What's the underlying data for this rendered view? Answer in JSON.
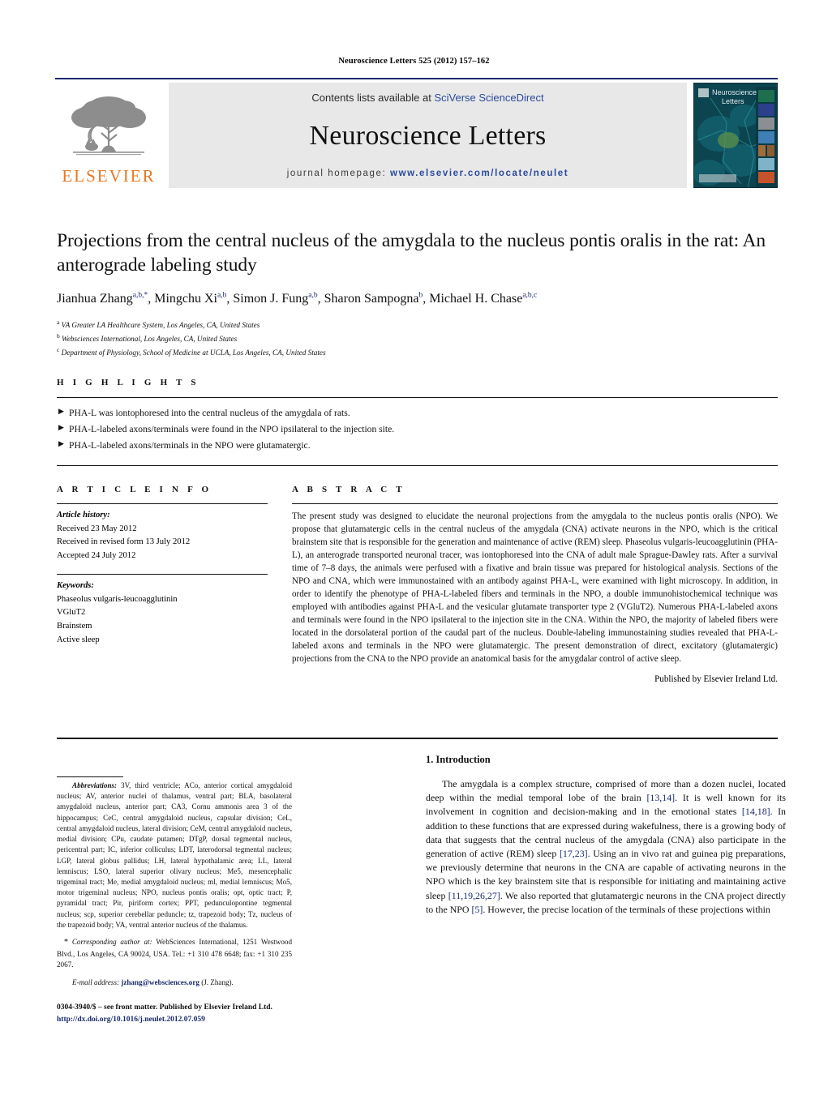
{
  "running_head": "Neuroscience Letters 525 (2012) 157–162",
  "masthead": {
    "contents_prefix": "Contents lists available at ",
    "contents_link": "SciVerse ScienceDirect",
    "journal_name": "Neuroscience Letters",
    "homepage_label": "journal homepage:",
    "homepage_url": "www.elsevier.com/locate/neulet",
    "publisher_wordmark": "ELSEVIER",
    "publisher_color": "#E87722",
    "cover_title_line1": "Neuroscience",
    "cover_title_line2": "Letters",
    "accent_color": "#1a2a6c",
    "link_color": "#2b4a9b"
  },
  "article": {
    "title": "Projections from the central nucleus of the amygdala to the nucleus pontis oralis in the rat: An anterograde labeling study",
    "authors_html": "Jianhua Zhang<sup>a,b,*</sup>, Mingchu Xi<sup>a,b</sup>, Simon J. Fung<sup>a,b</sup>, Sharon Sampogna<sup>b</sup>, Michael H. Chase<sup>a,b,c</sup>",
    "affiliations": [
      {
        "mark": "a",
        "text": "VA Greater LA Healthcare System, Los Angeles, CA, United States"
      },
      {
        "mark": "b",
        "text": "Websciences International, Los Angeles, CA, United States"
      },
      {
        "mark": "c",
        "text": "Department of Physiology, School of Medicine at UCLA, Los Angeles, CA, United States"
      }
    ]
  },
  "highlights": {
    "heading": "H I G H L I G H T S",
    "bullet_glyph": "▶",
    "items": [
      "PHA-L was iontophoresed into the central nucleus of the amygdala of rats.",
      "PHA-L-labeled axons/terminals were found in the NPO ipsilateral to the injection site.",
      "PHA-L-labeled axons/terminals in the NPO were glutamatergic."
    ]
  },
  "article_info": {
    "heading": "A R T I C L E    I N F O",
    "history_label": "Article history:",
    "history": [
      "Received 23 May 2012",
      "Received in revised form 13 July 2012",
      "Accepted 24 July 2012"
    ],
    "keywords_label": "Keywords:",
    "keywords": [
      "Phaseolus vulgaris-leucoagglutinin",
      "VGluT2",
      "Brainstem",
      "Active sleep"
    ]
  },
  "abstract": {
    "heading": "A B S T R A C T",
    "text": "The present study was designed to elucidate the neuronal projections from the amygdala to the nucleus pontis oralis (NPO). We propose that glutamatergic cells in the central nucleus of the amygdala (CNA) activate neurons in the NPO, which is the critical brainstem site that is responsible for the generation and maintenance of active (REM) sleep. Phaseolus vulgaris-leucoagglutinin (PHA-L), an anterograde transported neuronal tracer, was iontophoresed into the CNA of adult male Sprague-Dawley rats. After a survival time of 7–8 days, the animals were perfused with a fixative and brain tissue was prepared for histological analysis. Sections of the NPO and CNA, which were immunostained with an antibody against PHA-L, were examined with light microscopy. In addition, in order to identify the phenotype of PHA-L-labeled fibers and terminals in the NPO, a double immunohistochemical technique was employed with antibodies against PHA-L and the vesicular glutamate transporter type 2 (VGluT2). Numerous PHA-L-labeled axons and terminals were found in the NPO ipsilateral to the injection site in the CNA. Within the NPO, the majority of labeled fibers were located in the dorsolateral portion of the caudal part of the nucleus. Double-labeling immunostaining studies revealed that PHA-L-labeled axons and terminals in the NPO were glutamatergic. The present demonstration of direct, excitatory (glutamatergic) projections from the CNA to the NPO provide an anatomical basis for the amygdalar control of active sleep.",
    "publisher_line": "Published by Elsevier Ireland Ltd."
  },
  "footnotes": {
    "abbreviations_label": "Abbreviations:",
    "abbreviations_text": "3V, third ventricle; ACo, anterior cortical amygdaloid nucleus; AV, anterior nuclei of thalamus, ventral part; BLA, basolateral amygdaloid nucleus, anterior part; CA3, Cornu ammonis area 3 of the hippocampus; CeC, central amygdaloid nucleus, capsular division; CeL, central amygdaloid nucleus, lateral division; CeM, central amygdaloid nucleus, medial division; CPu, caudate putamen; DTgP, dorsal tegmental nucleus, pericentral part; IC, inferior colliculus; LDT, laterodorsal tegmental nucleus; LGP, lateral globus pallidus; LH, lateral hypothalamic area; LL, lateral lemniscus; LSO, lateral superior olivary nucleus; Me5, mesencephalic trigeminal tract; Me, medial amygdaloid nucleus; ml, medial lemniscus; Mo5, motor trigeminal nucleus; NPO, nucleus pontis oralis; opt, optic tract; P, pyramidal tract; Pir, piriform cortex; PPT, pedunculopontine tegmental nucleus; scp, superior cerebellar peduncle; tz, trapezoid body; Tz, nucleus of the trapezoid body; VA, ventral anterior nucleus of the thalamus.",
    "corresponding_star": "*",
    "corresponding_label": "Corresponding author at:",
    "corresponding_text": "WebSciences International, 1251 Westwood Blvd., Los Angeles, CA 90024, USA. Tel.: +1 310 478 6648; fax: +1 310 235 2067.",
    "email_label": "E-mail address:",
    "email_address": "jzhang@websciences.org",
    "email_owner": "(J. Zhang).",
    "front_matter": "0304-3940/$ – see front matter. Published by Elsevier Ireland Ltd.",
    "doi": "http://dx.doi.org/10.1016/j.neulet.2012.07.059"
  },
  "introduction": {
    "number_and_title": "1.  Introduction",
    "paragraph_part1": "The amygdala is a complex structure, comprised of more than a dozen nuclei, located deep within the medial temporal lobe of the brain ",
    "ref1": "[13,14]",
    "paragraph_part2": ". It is well known for its involvement in cognition and decision-making and in the emotional states ",
    "ref2": "[14,18]",
    "paragraph_part3": ". In addition to these functions that are expressed during wakefulness, there is a growing body of data that suggests that the central nucleus of the amygdala (CNA) also participate in the generation of active (REM) sleep ",
    "ref3": "[17,23]",
    "paragraph_part4": ". Using an in vivo rat and guinea pig preparations, we previously determine that neurons in the CNA are capable of activating neurons in the NPO which is the key brainstem site that is responsible for initiating and maintaining active sleep ",
    "ref4": "[11,19,26,27]",
    "paragraph_part5": ". We also reported that glutamatergic neurons in the CNA project directly to the NPO ",
    "ref5": "[5]",
    "paragraph_part6": ". However, the precise location of the terminals of these projections within"
  }
}
